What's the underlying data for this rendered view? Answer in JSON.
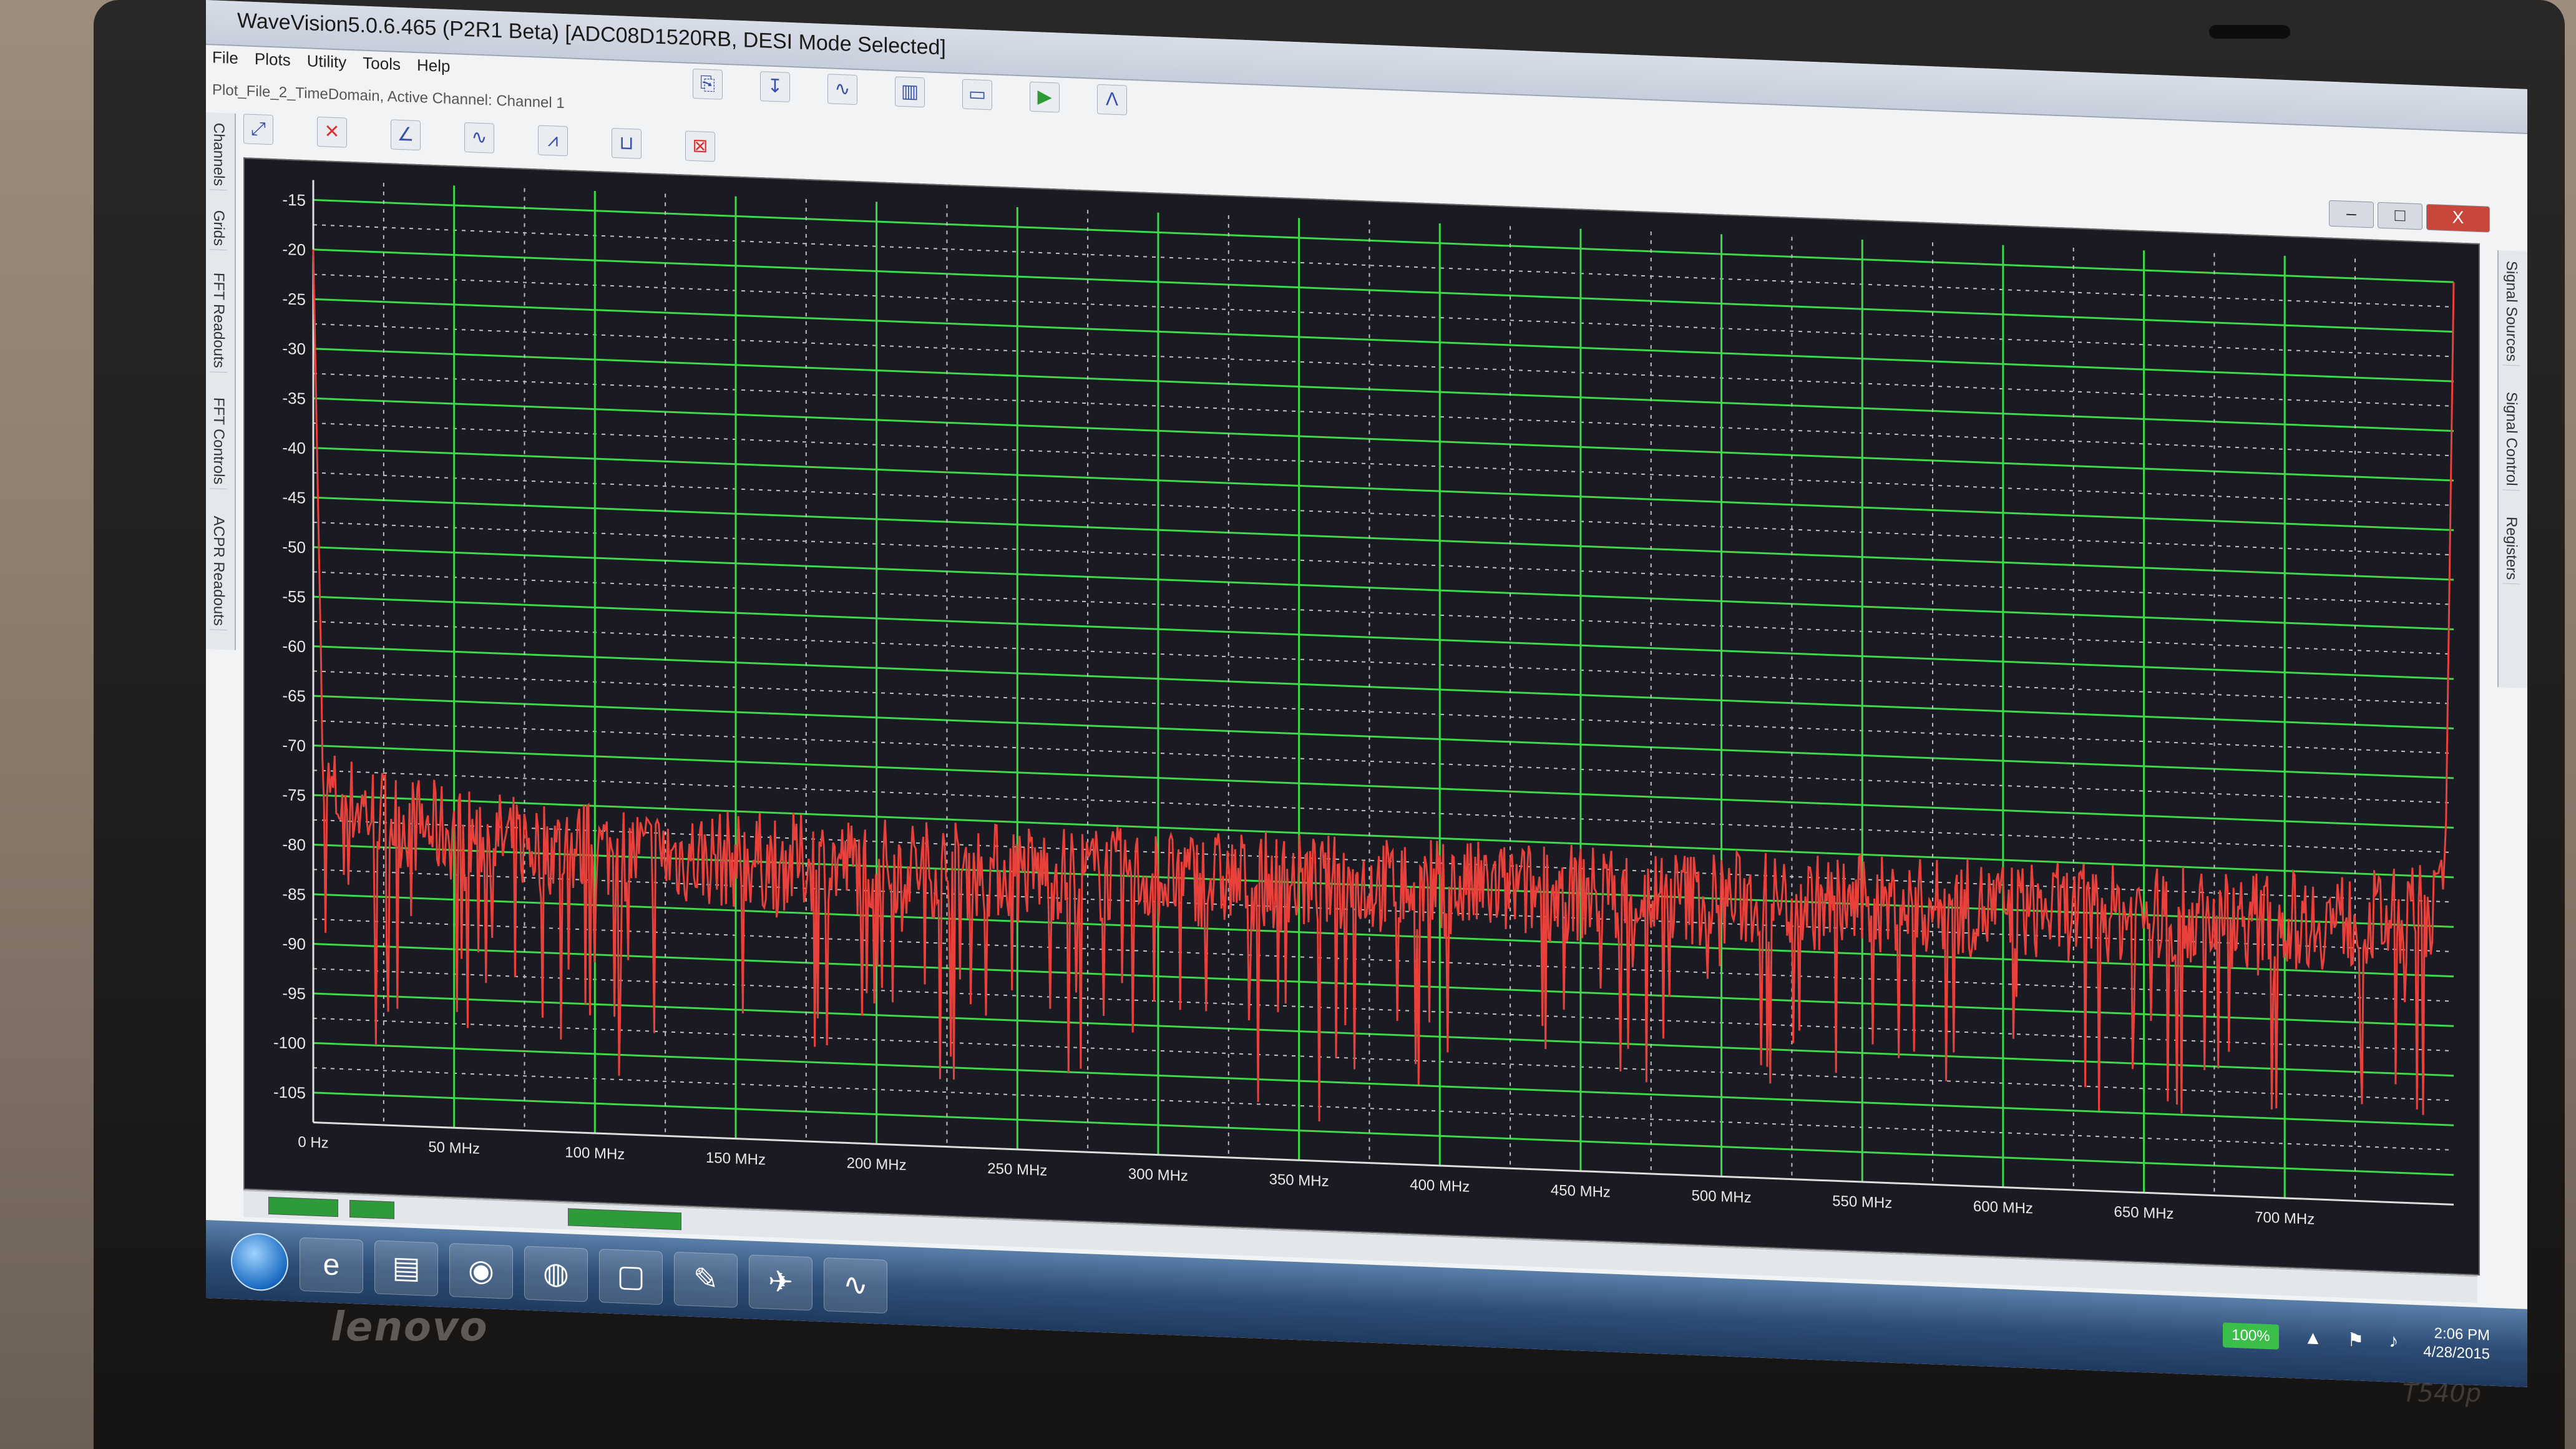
{
  "window": {
    "title": "WaveVision5.0.6.465 (P2R1 Beta)  [ADC08D1520RB, DESI Mode Selected]",
    "controls": [
      "–",
      "□",
      "X"
    ]
  },
  "menu": [
    "File",
    "Plots",
    "Utility",
    "Tools",
    "Help"
  ],
  "document_tab": "Plot_File_2_TimeDomain,  Active Channel:  Channel 1",
  "left_tabs": [
    "Channels",
    "Grids",
    "FFT Readouts",
    "FFT Controls",
    "ACPR Readouts"
  ],
  "right_tabs": [
    "Signal Sources",
    "Signal Control",
    "Registers"
  ],
  "plot": {
    "y_ticks": [
      "-15",
      "-20",
      "-25",
      "-30",
      "-35",
      "-40",
      "-45",
      "-50",
      "-55",
      "-60",
      "-65",
      "-70",
      "-75",
      "-80",
      "-85",
      "-90",
      "-95",
      "-100",
      "-105"
    ],
    "x_ticks": [
      "0 Hz",
      "50 MHz",
      "100 MHz",
      "150 MHz",
      "200 MHz",
      "250 MHz",
      "300 MHz",
      "350 MHz",
      "400 MHz",
      "450 MHz",
      "500 MHz",
      "550 MHz",
      "600 MHz",
      "650 MHz",
      "700 MHz"
    ],
    "grid_color": "#3ed84a",
    "trace_color": "#e8403a",
    "background": "#1a1a22",
    "ylim": [
      -108,
      -13
    ],
    "xlim": [
      0,
      760
    ]
  },
  "taskbar": {
    "battery": "100%",
    "time": "2:06 PM",
    "date": "4/28/2015"
  },
  "laptop": {
    "brand": "lenovo",
    "model": "T540p"
  }
}
